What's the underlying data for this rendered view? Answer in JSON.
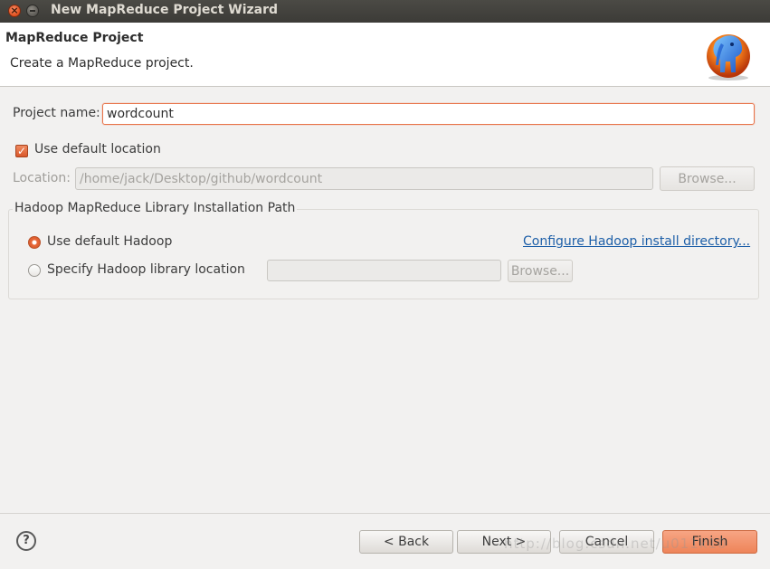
{
  "window": {
    "title": "New MapReduce Project Wizard"
  },
  "banner": {
    "title": "MapReduce Project",
    "description": "Create a MapReduce project."
  },
  "form": {
    "project_name_label": "Project name:",
    "project_name_value": "wordcount",
    "use_default_location_label": "Use default location",
    "use_default_location_checked": true,
    "location_label": "Location:",
    "location_value": "/home/jack/Desktop/github/wordcount",
    "browse_label": "Browse..."
  },
  "hadoop_group": {
    "title": "Hadoop MapReduce Library Installation Path",
    "use_default_label": "Use default Hadoop",
    "use_default_selected": true,
    "configure_link": "Configure Hadoop install directory...",
    "specify_label": "Specify Hadoop library location",
    "specify_value": "",
    "browse_label": "Browse..."
  },
  "footer": {
    "help_icon": "?",
    "back_label": "< Back",
    "next_label": "Next >",
    "cancel_label": "Cancel",
    "finish_label": "Finish"
  },
  "watermark": "http://blog.csdn.net/u011k10",
  "colors": {
    "accent": "#e9693a",
    "link": "#1d5fa8",
    "titlebar": "#3c3b37"
  }
}
